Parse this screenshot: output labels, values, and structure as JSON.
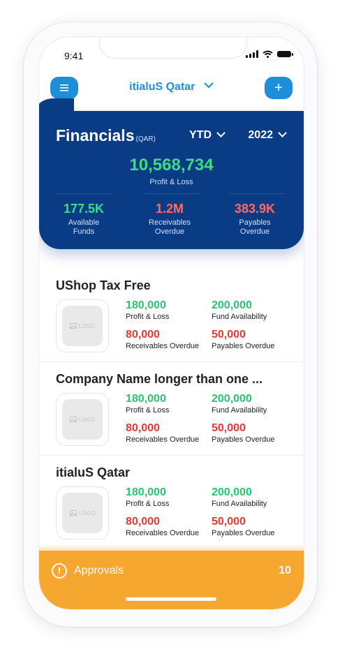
{
  "status": {
    "time": "9:41"
  },
  "header": {
    "company": "itialuS Qatar",
    "add_symbol": "+"
  },
  "financials": {
    "title": "Financials",
    "currency": "(QAR)",
    "period": "YTD",
    "year": "2022",
    "profit_loss_value": "10,568,734",
    "profit_loss_label": "Profit & Loss",
    "metrics": [
      {
        "value": "177.5K",
        "label_line1": "Available",
        "label_line2": "Funds",
        "color": "#3ddc84"
      },
      {
        "value": "1.2M",
        "label_line1": "Receivables",
        "label_line2": "Overdue",
        "color": "#ff6b6b"
      },
      {
        "value": "383.9K",
        "label_line1": "Payables",
        "label_line2": "Overdue",
        "color": "#ff6b6b"
      }
    ]
  },
  "companies": [
    {
      "name": "UShop Tax Free",
      "logo_text": "LOGO",
      "profit_loss": "180,000",
      "profit_loss_label": "Profit & Loss",
      "fund": "200,000",
      "fund_label": "Fund Availability",
      "receivables": "80,000",
      "receivables_label": "Receivables Overdue",
      "payables": "50,000",
      "payables_label": "Payables Overdue"
    },
    {
      "name": "Company Name longer than one ...",
      "logo_text": "LOGO",
      "profit_loss": "180,000",
      "profit_loss_label": "Profit & Loss",
      "fund": "200,000",
      "fund_label": "Fund Availability",
      "receivables": "80,000",
      "receivables_label": "Receivables Overdue",
      "payables": "50,000",
      "payables_label": "Payables Overdue"
    },
    {
      "name": "itialuS Qatar",
      "logo_text": "LOGO",
      "profit_loss": "180,000",
      "profit_loss_label": "Profit & Loss",
      "fund": "200,000",
      "fund_label": "Fund Availability",
      "receivables": "80,000",
      "receivables_label": "Receivables Overdue",
      "payables": "50,000",
      "payables_label": "Payables Overdue"
    }
  ],
  "approvals": {
    "icon": "!",
    "label": "Approvals",
    "count": "10"
  },
  "colors": {
    "accent": "#1f8ed8",
    "navy": "#0a3b85",
    "positive": "#2ac46f",
    "negative": "#e53935",
    "approvals_bg": "#f5a72f"
  },
  "icons": {
    "menu": "menu-icon",
    "add": "plus-icon",
    "chevron": "chevron-down-icon",
    "logo_placeholder": "image-icon",
    "approvals": "alert-circle-icon"
  }
}
